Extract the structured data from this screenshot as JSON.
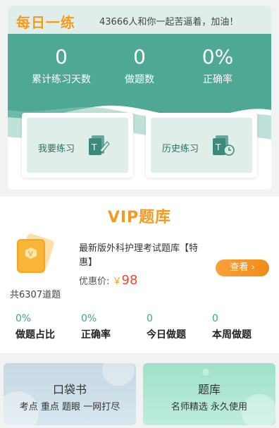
{
  "header": {
    "brand": "每日一练",
    "slogan": "43666人和你一起苦逼着，加油！"
  },
  "stats": [
    {
      "value": "0",
      "label": "累计练习天数"
    },
    {
      "value": "0",
      "label": "做题数"
    },
    {
      "value": "0%",
      "label": "正确率"
    }
  ],
  "entries": {
    "practice": "我要练习",
    "history": "历史练习"
  },
  "vip": {
    "title": "VIP题库",
    "total": "共6307道题",
    "book_title": "最新版外科护理考试题库【特惠】",
    "price_label": "优惠价:",
    "price_symbol": "￥",
    "price_value": "98",
    "view_button": "查看",
    "metrics": [
      {
        "value": "0%",
        "label": "做题占比"
      },
      {
        "value": "0%",
        "label": "正确率"
      },
      {
        "value": "0",
        "label": "今日做题"
      },
      {
        "value": "0",
        "label": "本周做题"
      }
    ]
  },
  "tiles": {
    "pocket": {
      "title": "口袋书",
      "subtitle": "考点 重点 题眼 一网打尽"
    },
    "bank": {
      "title": "题库",
      "subtitle": "名师精选 永久使用"
    }
  },
  "colors": {
    "accent": "#f39a22",
    "teal": "#4fa894",
    "price": "#e84a2f"
  }
}
